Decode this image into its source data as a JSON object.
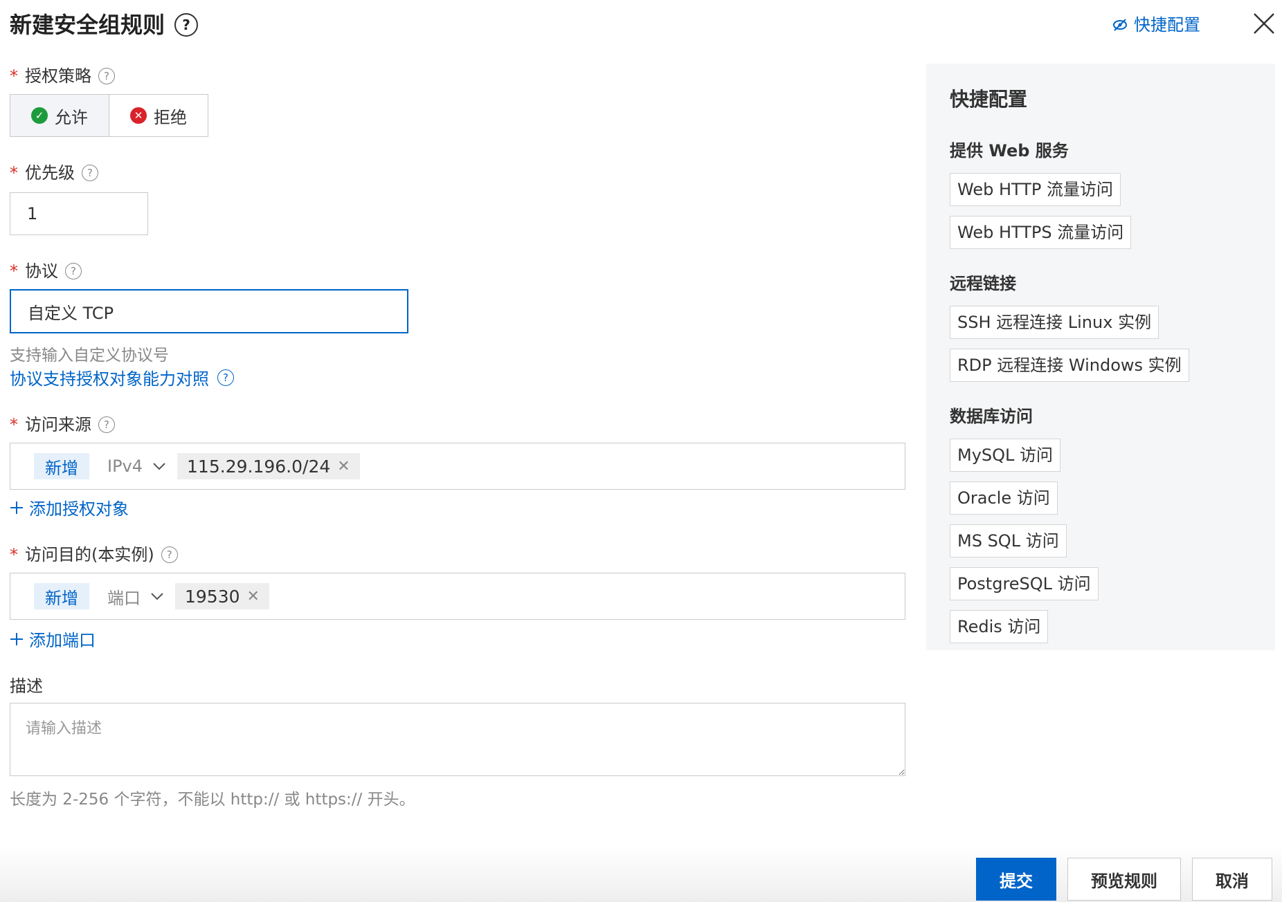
{
  "header": {
    "title": "新建安全组规则",
    "quick_config_link": "快捷配置",
    "help_glyph": "?"
  },
  "policy": {
    "label": "授权策略",
    "options": [
      {
        "label": "允许",
        "selected": true
      },
      {
        "label": "拒绝",
        "selected": false
      }
    ]
  },
  "priority": {
    "label": "优先级",
    "value": "1"
  },
  "protocol": {
    "label": "协议",
    "value": "自定义 TCP",
    "hint": "支持输入自定义协议号",
    "link": "协议支持授权对象能力对照"
  },
  "source": {
    "label": "访问来源",
    "add_badge": "新增",
    "selector": "IPv4",
    "chips": [
      "115.29.196.0/24"
    ],
    "add_link": "添加授权对象"
  },
  "destination": {
    "label": "访问目的(本实例)",
    "add_badge": "新增",
    "selector": "端口",
    "chips": [
      "19530"
    ],
    "add_link": "添加端口"
  },
  "description": {
    "label": "描述",
    "placeholder": "请输入描述",
    "hint": "长度为 2-256 个字符，不能以 http:// 或 https:// 开头。"
  },
  "quick_config": {
    "title": "快捷配置",
    "groups": [
      {
        "title": "提供 Web 服务",
        "items": [
          "Web HTTP 流量访问",
          "Web HTTPS 流量访问"
        ]
      },
      {
        "title": "远程链接",
        "items": [
          "SSH 远程连接 Linux 实例",
          "RDP 远程连接 Windows 实例"
        ]
      },
      {
        "title": "数据库访问",
        "items": [
          "MySQL 访问",
          "Oracle 访问",
          "MS SQL 访问",
          "PostgreSQL 访问",
          "Redis 访问"
        ]
      }
    ]
  },
  "footer": {
    "submit": "提交",
    "preview": "预览规则",
    "cancel": "取消"
  },
  "colors": {
    "primary": "#0064c8",
    "required": "#d93026",
    "allow": "#1e9b3c",
    "deny": "#d9222a"
  },
  "icons": {
    "allow": "check-circle-icon",
    "deny": "x-circle-icon",
    "close": "close-icon",
    "quick": "eye-off-icon",
    "chevron": "chevron-down-icon",
    "plus": "plus-icon"
  }
}
